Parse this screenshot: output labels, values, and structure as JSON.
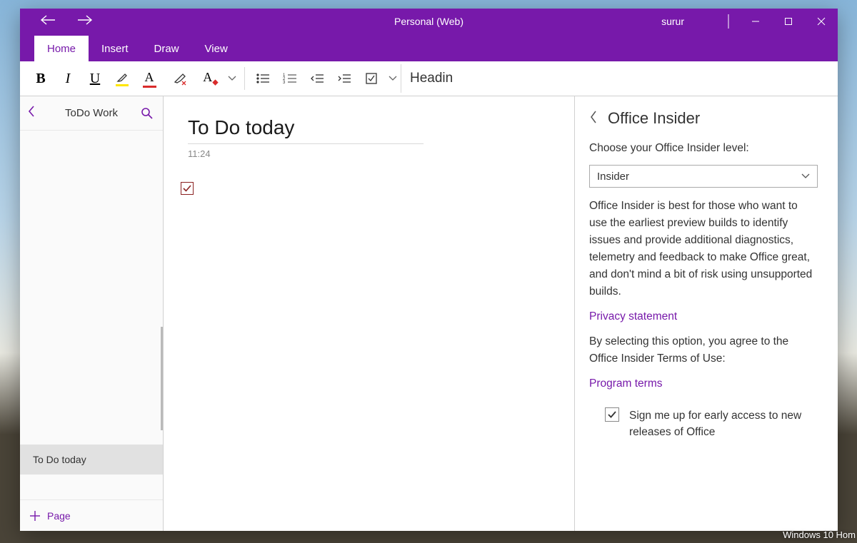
{
  "titlebar": {
    "title": "Personal (Web)",
    "user": "surur"
  },
  "tabs": [
    "Home",
    "Insert",
    "Draw",
    "View"
  ],
  "active_tab": 0,
  "ribbon": {
    "heading": "Headin"
  },
  "sidebar": {
    "section": "ToDo Work",
    "pages": [
      "To Do today"
    ],
    "add_label": "Page"
  },
  "note": {
    "title": "To Do today",
    "time": "11:24"
  },
  "panel": {
    "title": "Office Insider",
    "label": "Choose your Office Insider level:",
    "select": "Insider",
    "description": "Office Insider is best for those who want to use the earliest preview builds to identify issues and provide additional diagnostics, telemetry and feedback to make Office great, and don't mind a bit of risk using unsupported builds.",
    "privacy": "Privacy statement",
    "consent": "By selecting this option, you agree to the Office Insider Terms of Use:",
    "terms": "Program terms",
    "signup": "Sign me up for early access to new releases of Office"
  },
  "watermark": "Windows 10 Hom"
}
